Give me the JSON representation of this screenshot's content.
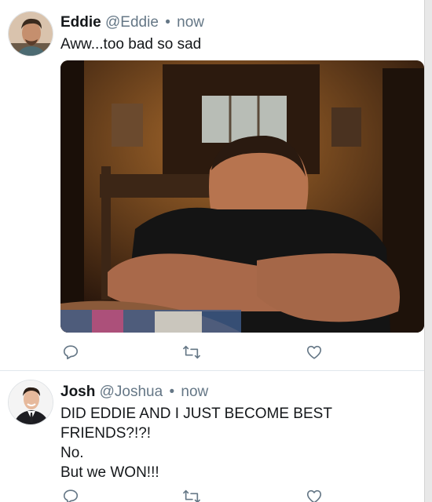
{
  "tweets": [
    {
      "name": "Eddie",
      "handle": "@Eddie",
      "separator": "•",
      "time": "now",
      "lines": [
        "Aww...too bad so sad"
      ],
      "has_media": true
    },
    {
      "name": "Josh",
      "handle": "@Joshua",
      "separator": "•",
      "time": "now",
      "lines": [
        "DID EDDIE AND I JUST BECOME BEST FRIENDS?!?!",
        "No.",
        "But we WON!!!"
      ],
      "has_media": false
    }
  ],
  "icons": {
    "reply": "reply-icon",
    "retweet": "retweet-icon",
    "like": "heart-icon"
  },
  "colors": {
    "text": "#14171a",
    "secondary": "#657786",
    "divider": "#e1e8ed"
  }
}
